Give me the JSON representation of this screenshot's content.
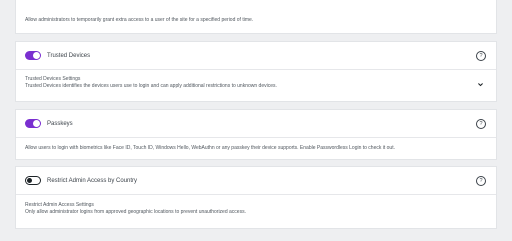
{
  "top_card": {
    "description": "Allow administrators to temporarily grant extra access to a user of the site for a specified period of time."
  },
  "features": [
    {
      "title": "Trusted Devices",
      "enabled": true,
      "settings_title": "Trusted Devices Settings",
      "description": "Trusted Devices identifies the devices users use to login and can apply additional restrictions to unknown devices."
    },
    {
      "title": "Passkeys",
      "enabled": true,
      "description": "Allow users to login with biometrics like Face ID, Touch ID, Windows Hello, WebAuthn or any passkey their device supports. Enable Passwordless Login to check it out."
    },
    {
      "title": "Restrict Admin Access by Country",
      "enabled": false,
      "settings_title": "Restrict Admin Access Settings",
      "description": "Only allow administrator logins from approved geographic locations to prevent unauthorized access."
    }
  ],
  "help_glyph": "?",
  "colors": {
    "accent": "#7a2fd0",
    "background": "#eeeff1",
    "card": "#ffffff"
  },
  "icons": {
    "help": "help-circle-icon",
    "expand": "chevron-down-icon"
  }
}
